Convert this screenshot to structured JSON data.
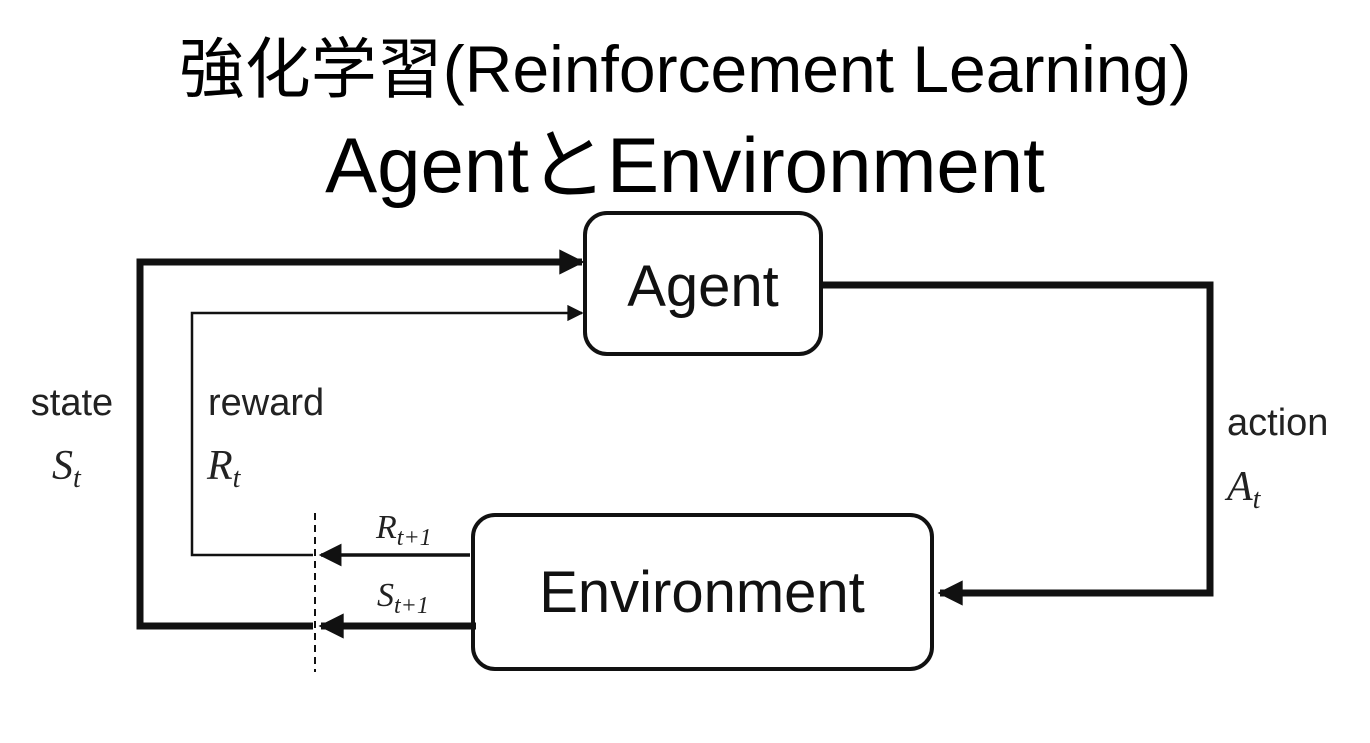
{
  "header": {
    "title_line_1": "強化学習(Reinforcement Learning)",
    "title_line_2": "AgentとEnvironment"
  },
  "diagram": {
    "agent_label": "Agent",
    "environment_label": "Environment",
    "state": {
      "label": "state",
      "symbol": "S",
      "subscript": "t"
    },
    "reward": {
      "label": "reward",
      "symbol": "R",
      "subscript": "t"
    },
    "action": {
      "label": "action",
      "symbol": "A",
      "subscript": "t"
    },
    "next_reward": {
      "symbol": "R",
      "subscript": "t+1"
    },
    "next_state": {
      "symbol": "S",
      "subscript": "t+1"
    }
  },
  "colors": {
    "line": "#111111",
    "box_border": "#111111",
    "background": "#ffffff"
  }
}
